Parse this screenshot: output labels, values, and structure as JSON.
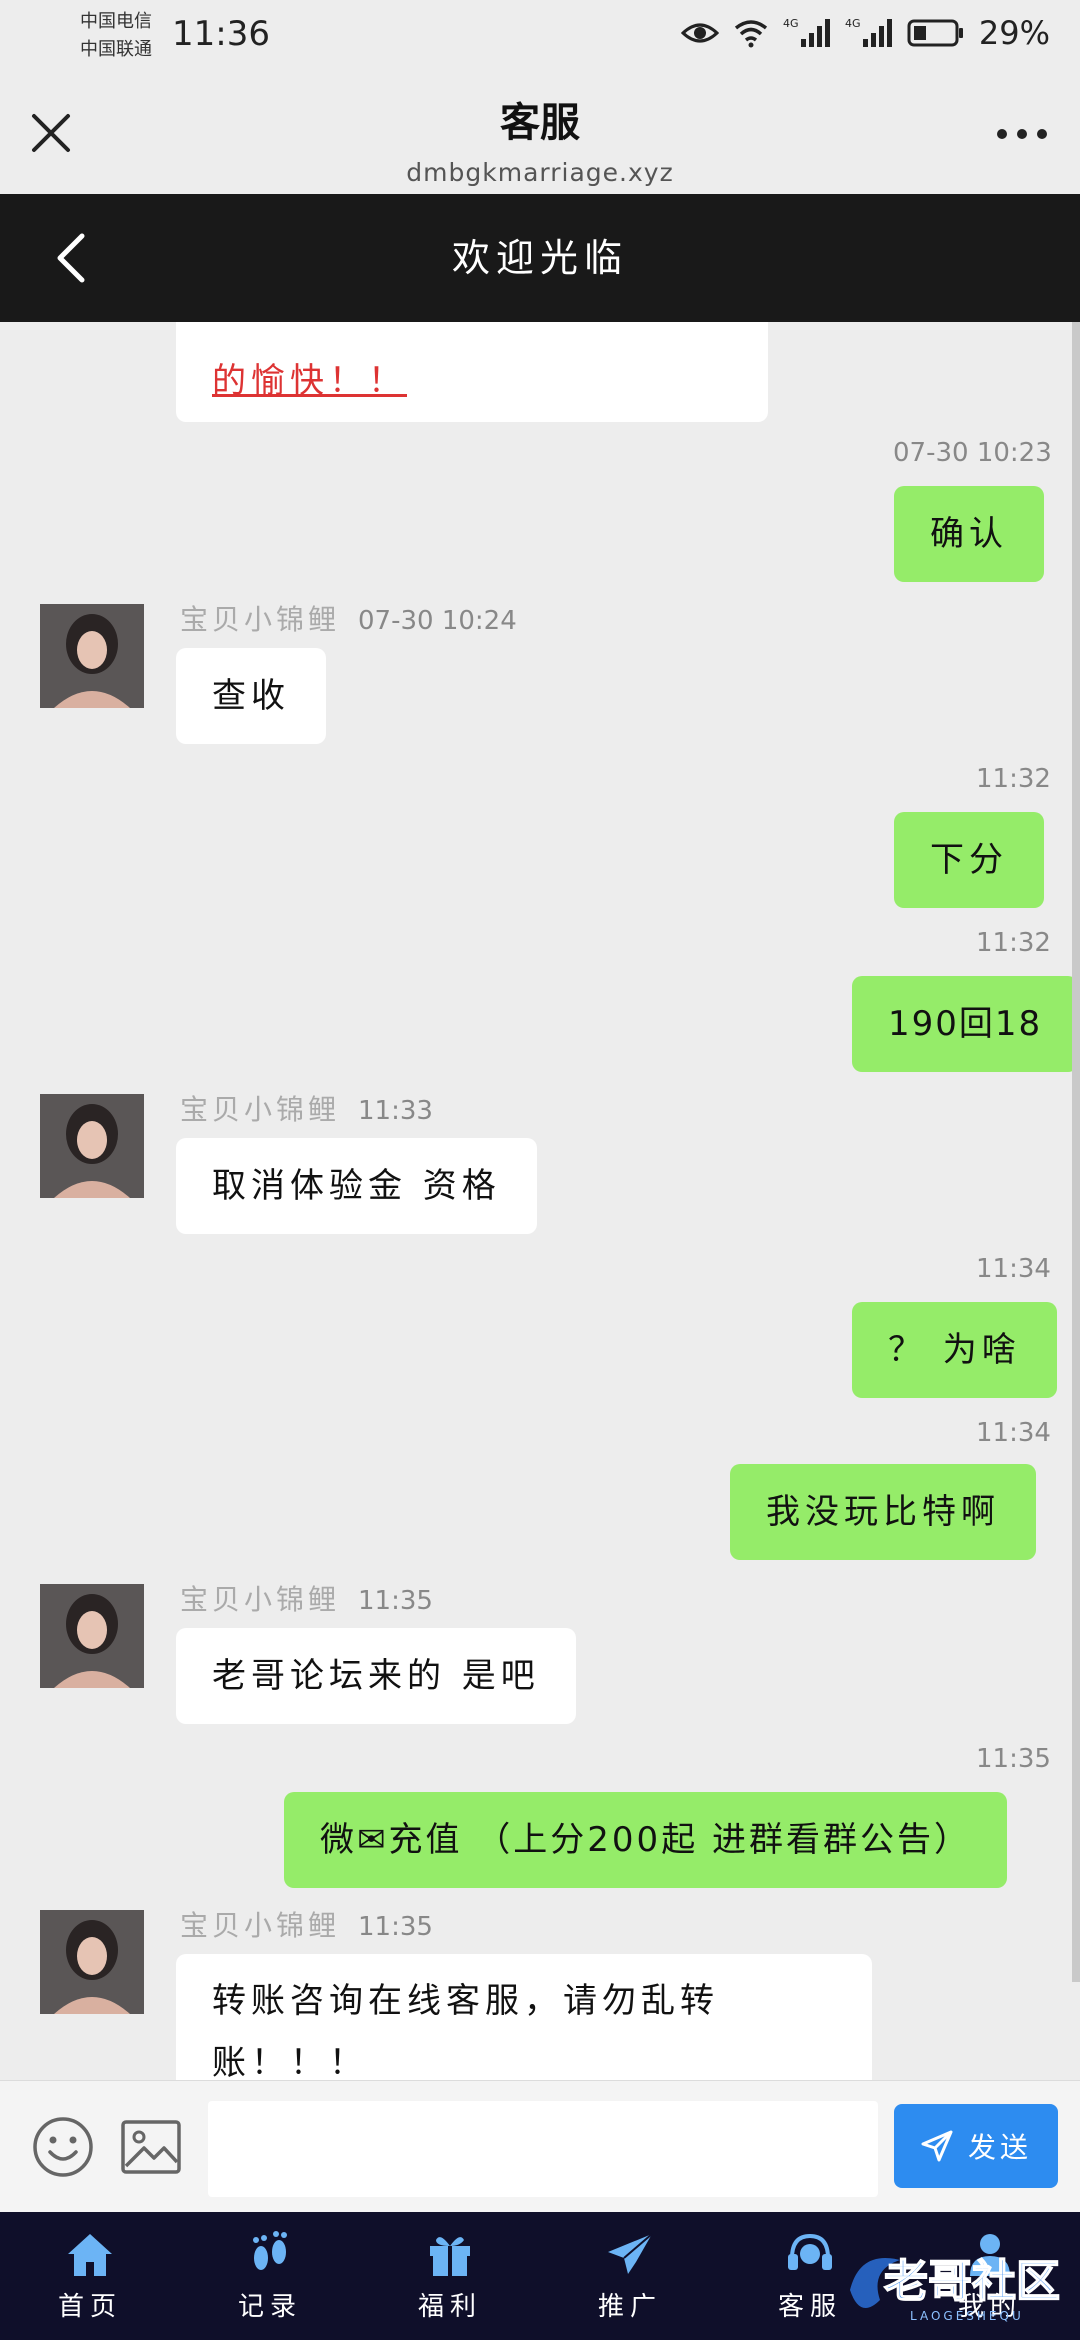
{
  "status_bar": {
    "carrier1": "中国电信",
    "carrier2": "中国联通",
    "time": "11:36",
    "signal1": "4G",
    "signal2": "4G",
    "battery": "29%"
  },
  "title_bar": {
    "title": "客服",
    "subtitle": "dmbgkmarriage.xyz"
  },
  "chat_header": {
    "title": "欢迎光临"
  },
  "messages": [
    {
      "side": "left",
      "text": "的愉快！！"
    },
    {
      "side": "right",
      "time": "07-30 10:23",
      "text": "确认"
    },
    {
      "side": "left",
      "sender": "宝贝小锦鲤",
      "time": "07-30 10:24",
      "text": "查收"
    },
    {
      "side": "right",
      "time": "11:32",
      "text": "下分"
    },
    {
      "side": "right",
      "time": "11:32",
      "text": "190回18"
    },
    {
      "side": "left",
      "sender": "宝贝小锦鲤",
      "time": "11:33",
      "text": "取消体验金 资格"
    },
    {
      "side": "right",
      "time": "11:34",
      "text": "？ 为啥"
    },
    {
      "side": "right",
      "time": "11:34",
      "text": "我没玩比特啊"
    },
    {
      "side": "left",
      "sender": "宝贝小锦鲤",
      "time": "11:35",
      "text": "老哥论坛来的 是吧"
    },
    {
      "side": "right",
      "time": "11:35",
      "text": "微✉充值 （上分200起 进群看群公告）"
    },
    {
      "side": "left",
      "sender": "宝贝小锦鲤",
      "time": "11:35",
      "text_line1": "转账咨询在线客服，请勿乱转",
      "text_line2": "账！！！"
    }
  ],
  "input": {
    "value": "",
    "send_label": "发送"
  },
  "nav": [
    {
      "label": "首页",
      "icon": "home-icon"
    },
    {
      "label": "记录",
      "icon": "footprint-icon"
    },
    {
      "label": "福利",
      "icon": "gift-icon"
    },
    {
      "label": "推广",
      "icon": "paper-plane-icon"
    },
    {
      "label": "客服",
      "icon": "headset-icon"
    },
    {
      "label": "我的",
      "icon": "user-icon"
    }
  ],
  "watermark": {
    "text": "老哥社区",
    "sub": "LAOGESHEQU"
  },
  "colors": {
    "background": "#ededed",
    "header": "#191919",
    "bubble_right": "#95ec69",
    "bubble_left": "#ffffff",
    "send_button": "#2d8cf0",
    "nav_bg": "#0f0f2a",
    "link_red": "#dd3333"
  }
}
